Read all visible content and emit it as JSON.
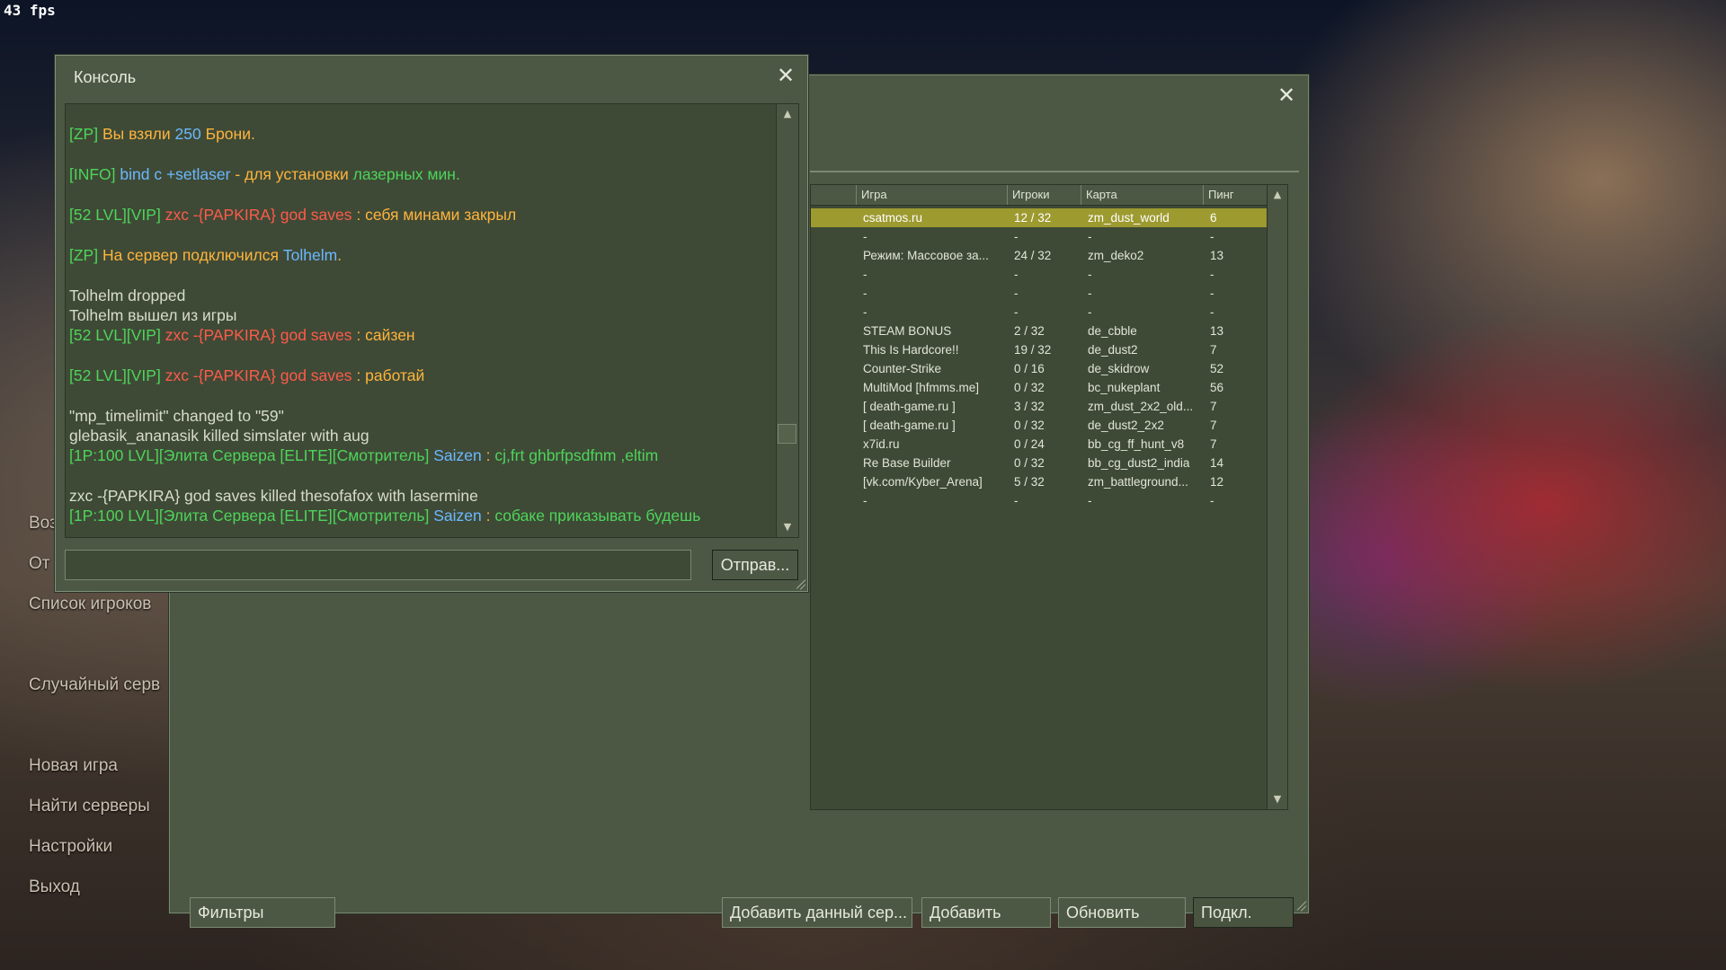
{
  "fps": "43 fps",
  "main_menu": {
    "items": [
      "Воз",
      "От",
      "Список игроков",
      "Случайный серв",
      "Новая игра",
      "Найти серверы",
      "Настройки",
      "Выход"
    ]
  },
  "console": {
    "title": "Консоль",
    "close_icon": "close-icon",
    "send_label": "Отправ...",
    "input_value": "",
    "lines": [
      [
        {
          "t": "[ZP] ",
          "c": "g"
        },
        {
          "t": "Вы взяли ",
          "c": "o"
        },
        {
          "t": "250",
          "c": "b"
        },
        {
          "t": " Брони.",
          "c": "o"
        }
      ],
      [
        {
          "t": "[INFO] ",
          "c": "g"
        },
        {
          "t": "bind c +setlaser",
          "c": "b"
        },
        {
          "t": " - для установки ",
          "c": "o"
        },
        {
          "t": "лазерных мин.",
          "c": "g"
        }
      ],
      [
        {
          "t": "[52 LVL][VIP] ",
          "c": "g"
        },
        {
          "t": "zxc -{PAPKIRA} god saves",
          "c": "r"
        },
        {
          "t": " : себя минами закрыл",
          "c": "o"
        }
      ],
      [
        {
          "t": "[ZP] ",
          "c": "g"
        },
        {
          "t": "На сервер подключился ",
          "c": "o"
        },
        {
          "t": "Tolhelm",
          "c": "b"
        },
        {
          "t": ".",
          "c": "o"
        }
      ],
      [
        {
          "t": "Tolhelm dropped",
          "c": "w"
        }
      ],
      [
        {
          "t": "Tolhelm вышел из игры",
          "c": "w"
        }
      ],
      [
        {
          "t": "[52 LVL][VIP] ",
          "c": "g"
        },
        {
          "t": "zxc -{PAPKIRA} god saves",
          "c": "r"
        },
        {
          "t": " : сайзен",
          "c": "o"
        }
      ],
      [
        {
          "t": "[52 LVL][VIP] ",
          "c": "g"
        },
        {
          "t": "zxc -{PAPKIRA} god saves",
          "c": "r"
        },
        {
          "t": " : работай",
          "c": "o"
        }
      ],
      [
        {
          "t": "\"mp_timelimit\" changed to \"59\"",
          "c": "w"
        }
      ],
      [
        {
          "t": "glebasik_ananasik killed simslater with aug",
          "c": "w"
        }
      ],
      [
        {
          "t": "[1P:100 LVL][Элита Сервера [ELITE][Смотритель] ",
          "c": "g"
        },
        {
          "t": "Saizen",
          "c": "b"
        },
        {
          "t": " : ",
          "c": "o"
        },
        {
          "t": "cj,frt ghbrfpsdfnm ,eltim",
          "c": "g"
        }
      ],
      [
        {
          "t": "zxc -{PAPKIRA} god saves killed thesofafox with lasermine",
          "c": "w"
        }
      ],
      [
        {
          "t": "[1P:100 LVL][Элита Сервера [ELITE][Смотритель] ",
          "c": "g"
        },
        {
          "t": "Saizen",
          "c": "b"
        },
        {
          "t": " : ",
          "c": "o"
        },
        {
          "t": "собаке приказывать будешь",
          "c": "g"
        }
      ]
    ]
  },
  "browser": {
    "close_icon": "close-icon",
    "columns": [
      "Игра",
      "Игроки",
      "Карта",
      "Пинг"
    ],
    "rows": [
      [
        "csatmos.ru",
        "12 / 32",
        "zm_dust_world",
        "6"
      ],
      [
        "-",
        "-",
        "-",
        "-"
      ],
      [
        "Режим: Массовое за...",
        "24 / 32",
        "zm_deko2",
        "13"
      ],
      [
        "-",
        "-",
        "-",
        "-"
      ],
      [
        "-",
        "-",
        "-",
        "-"
      ],
      [
        "-",
        "-",
        "-",
        "-"
      ],
      [
        "STEAM BONUS",
        "2 / 32",
        "de_cbble",
        "13"
      ],
      [
        "This Is Hardcore!!",
        "19 / 32",
        "de_dust2",
        "7"
      ],
      [
        "Counter-Strike",
        "0 / 16",
        "de_skidrow",
        "52"
      ],
      [
        "MultiMod [hfmms.me]",
        "0 / 32",
        "bc_nukeplant",
        "56"
      ],
      [
        "[ death-game.ru ]",
        "3 / 32",
        "zm_dust_2x2_old...",
        "7"
      ],
      [
        "[ death-game.ru ]",
        "0 / 32",
        "de_dust2_2x2",
        "7"
      ],
      [
        "x7id.ru",
        "0 / 24",
        "bb_cg_ff_hunt_v8",
        "7"
      ],
      [
        "Re Base Builder",
        "0 / 32",
        "bb_cg_dust2_india",
        "14"
      ],
      [
        "[vk.com/Kyber_Arena]",
        "5 / 32",
        "zm_battleground...",
        "12"
      ],
      [
        "-",
        "-",
        "-",
        "-"
      ]
    ],
    "buttons": {
      "filters": "Фильтры",
      "add_current": "Добавить данный сер...",
      "add": "Добавить",
      "refresh": "Обновить",
      "connect": "Подкл."
    }
  },
  "colors": {
    "g": "#4ed45a",
    "o": "#ffb43c",
    "b": "#6cb8ff",
    "r": "#ff5a4a",
    "w": "#d8dcc8",
    "selected_row": "#9d9a30"
  }
}
